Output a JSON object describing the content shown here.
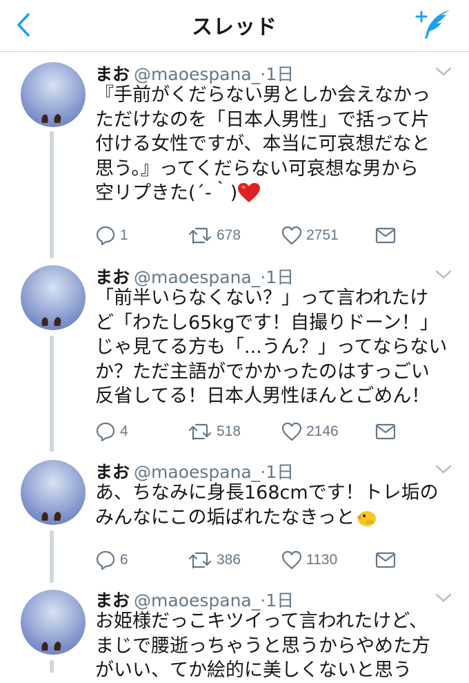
{
  "header": {
    "title": "スレッド"
  },
  "tweets": [
    {
      "name": "まお",
      "handle": "@maoespana_",
      "time": "·1日",
      "lines": [
        "『手前がくだらない男としか会えなかっ",
        "ただけなのを「日本人男性」で括って片",
        "付ける女性ですが、本当に可哀想だなと",
        "思う。』ってくだらない可哀想な男から",
        "空リプきた(´-｀)"
      ],
      "emoji": "red-heart",
      "replies": "1",
      "retweets": "678",
      "likes": "2751"
    },
    {
      "name": "まお",
      "handle": "@maoespana_",
      "time": "·1日",
      "lines": [
        "「前半いらなくない？」って言われたけ",
        "ど「わたし65kgです！自撮りドーン！」",
        "じゃ見てる方も「...うん？」ってならない",
        "か？ただ主語がでかかったのはすっごい",
        "反省してる！日本人男性ほんとごめん！"
      ],
      "replies": "4",
      "retweets": "518",
      "likes": "2146"
    },
    {
      "name": "まお",
      "handle": "@maoespana_",
      "time": "·1日",
      "lines": [
        "あ、ちなみに身長168cmです！トレ垢の",
        "みんなにこの垢ばれたなきっと"
      ],
      "emoji": "baby-chick",
      "replies": "6",
      "retweets": "386",
      "likes": "1130"
    },
    {
      "name": "まお",
      "handle": "@maoespana_",
      "time": "·1日",
      "lines": [
        "お姫様だっこキツイって言われたけど、",
        "まじで腰逝っちゃうと思うからやめた方",
        "がいい、てか絵的に美しくないと思う"
      ]
    }
  ],
  "colors": {
    "accent": "#1da1f2",
    "muted": "#657786",
    "divider": "#d3d3d3",
    "heart": "#e0245e"
  }
}
